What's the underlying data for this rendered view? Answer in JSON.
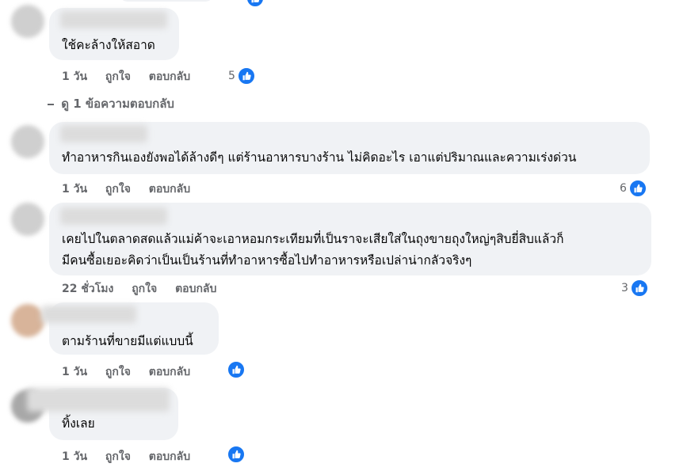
{
  "comments": [
    {
      "text": [
        "ใช้คะล้างให้สอาด"
      ],
      "time": "1 วัน",
      "like": "ถูกใจ",
      "reply": "ตอบกลับ",
      "reactions": "5"
    },
    {
      "text": [
        "ทำอาหารกินเองยังพอได้ล้างดีๆ แต่ร้านอาหารบางร้าน ไม่คิดอะไร เอาแต่ปริมาณและความเร่งด่วน"
      ],
      "time": "1 วัน",
      "like": "ถูกใจ",
      "reply": "ตอบกลับ",
      "reactions": "6"
    },
    {
      "text": [
        "เคยไปในตลาดสดแล้วแม่ค้าจะเอาหอมกระเทียมที่เป็นราจะเสียใส่ในถุงขายถุงใหญ่ๆสิบยี่สิบแล้วก็",
        "มีคนซื้อเยอะคิดว่าเป็นเป็นร้านที่ทำอาหารซื้อไปทำอาหารหรือเปล่าน่ากลัวจริงๆ"
      ],
      "time": "22 ชั่วโมง",
      "like": "ถูกใจ",
      "reply": "ตอบกลับ",
      "reactions": "3"
    },
    {
      "text": [
        "ตามร้านที่ขายมีแต่แบบนี้"
      ],
      "time": "1 วัน",
      "like": "ถูกใจ",
      "reply": "ตอบกลับ",
      "reactions": ""
    },
    {
      "text": [
        "ทิ้งเลย"
      ],
      "time": "1 วัน",
      "like": "ถูกใจ",
      "reply": "ตอบกลับ",
      "reactions": ""
    }
  ],
  "view_replies": "ดู 1 ข้อความตอบกลับ",
  "colors": {
    "bubble": "#f0f2f5",
    "like_blue": "#1877f2",
    "meta_gray": "#65676b"
  },
  "icons": {
    "reaction": "like-thumb-icon",
    "reply_arrow": "reply-arrow-icon"
  }
}
